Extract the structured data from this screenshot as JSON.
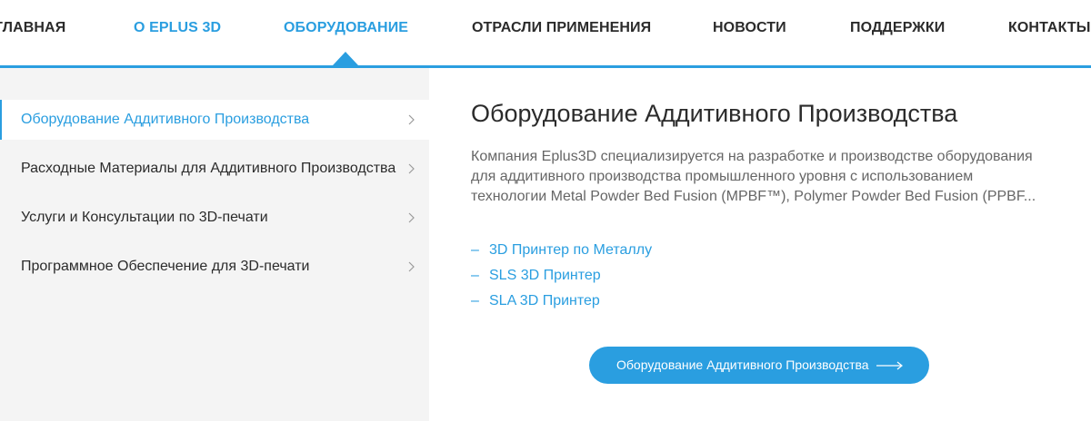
{
  "nav": {
    "items": [
      {
        "label": "ГЛАВНАЯ"
      },
      {
        "label": "О EPLUS 3D"
      },
      {
        "label": "ОБОРУДОВАНИЕ"
      },
      {
        "label": "ОТРАСЛИ ПРИМЕНЕНИЯ"
      },
      {
        "label": "НОВОСТИ"
      },
      {
        "label": "ПОДДЕРЖКИ"
      },
      {
        "label": "КОНТАКТЫ"
      }
    ],
    "active_index": 2
  },
  "sidebar": {
    "items": [
      {
        "label": "Оборудование Аддитивного Производства",
        "active": true
      },
      {
        "label": "Расходные Материалы для Аддитивного Производства",
        "active": false
      },
      {
        "label": "Услуги и Консультации по 3D-печати",
        "active": false
      },
      {
        "label": "Программное Обеспечение для 3D-печати",
        "active": false
      }
    ]
  },
  "main": {
    "title": "Оборудование Аддитивного Производства",
    "description_lines": [
      "Компания Eplus3D специализируется на разработке и производстве оборудования",
      "для аддитивного производства промышленного уровня с использованием",
      "технологии Metal Powder Bed Fusion (MPBF™), Polymer Powder Bed Fusion (PPBF..."
    ],
    "links": [
      {
        "dash": "–",
        "label": "3D Принтер по Металлу"
      },
      {
        "dash": "–",
        "label": "SLS 3D Принтер"
      },
      {
        "dash": "–",
        "label": "SLA 3D Принтер"
      }
    ],
    "cta_label": "Оборудование Аддитивного Производства"
  },
  "icons": {
    "chevron": "chevron-right-icon",
    "arrow": "long-arrow-right-icon"
  },
  "colors": {
    "accent": "#2a9ee0",
    "text": "#2b2b2b",
    "muted": "#666666",
    "panel": "#f4f4f4"
  }
}
